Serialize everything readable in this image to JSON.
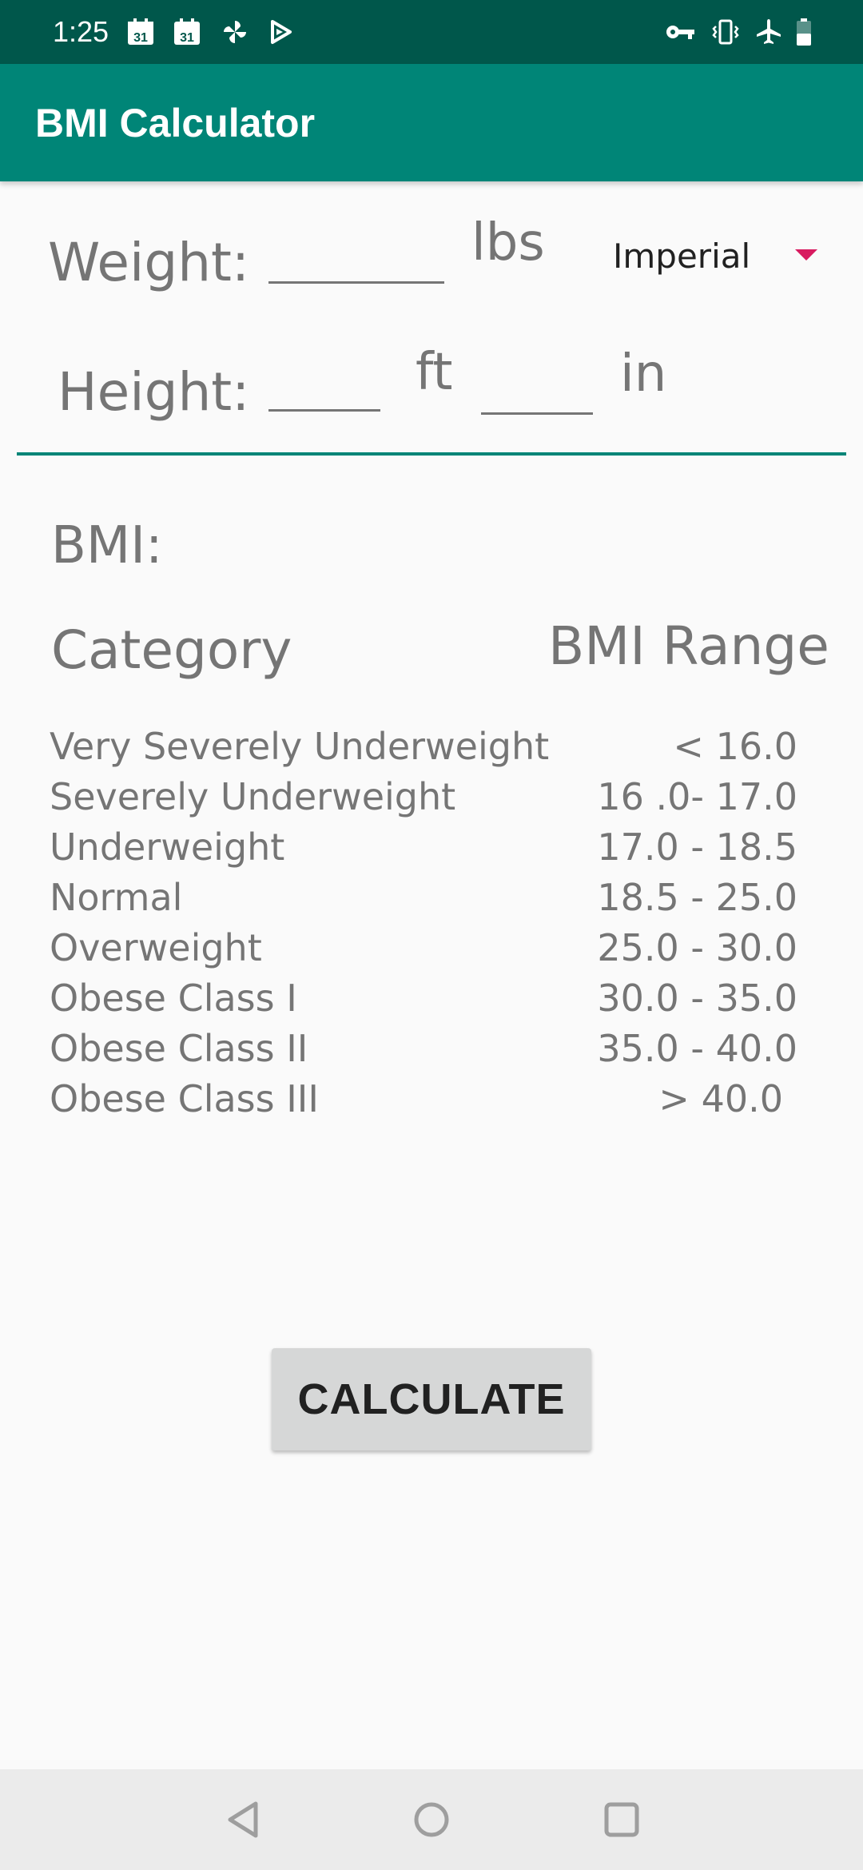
{
  "status_bar": {
    "time": "1:25",
    "calendar_day_1": "31",
    "calendar_day_2": "31"
  },
  "app_bar": {
    "title": "BMI Calculator"
  },
  "form": {
    "weight_label": "Weight:",
    "weight_value": "",
    "weight_unit": "lbs",
    "unit_system": "Imperial",
    "height_label": "Height:",
    "height_feet_value": "",
    "feet_unit": "ft",
    "height_inches_value": "",
    "inches_unit": "in"
  },
  "result": {
    "bmi_label": "BMI:",
    "bmi_value": ""
  },
  "table": {
    "category_header": "Category",
    "range_header": "BMI Range",
    "rows": [
      {
        "category": "Very Severely Underweight",
        "range": "< 16.0"
      },
      {
        "category": "Severely Underweight",
        "range": "16 .0- 17.0"
      },
      {
        "category": "Underweight",
        "range": "17.0 - 18.5"
      },
      {
        "category": "Normal",
        "range": "18.5 - 25.0"
      },
      {
        "category": "Overweight",
        "range": "25.0 - 30.0"
      },
      {
        "category": "Obese Class I",
        "range": "30.0 - 35.0"
      },
      {
        "category": "Obese Class II",
        "range": "35.0 - 40.0"
      },
      {
        "category": "Obese Class III",
        "range": "> 40.0"
      }
    ]
  },
  "actions": {
    "calculate_label": "CALCULATE"
  },
  "icons": {
    "status": [
      "calendar-icon",
      "calendar-icon",
      "pinwheel-icon",
      "play-store-icon",
      "vpn-key-icon",
      "vibrate-icon",
      "airplane-mode-icon",
      "battery-icon"
    ],
    "nav": [
      "back-icon",
      "home-icon",
      "recents-icon"
    ]
  },
  "colors": {
    "status_bar": "#00574b",
    "primary": "#008577",
    "accent": "#d81b60",
    "button": "#d6d7d7",
    "text_secondary": "#757575"
  }
}
